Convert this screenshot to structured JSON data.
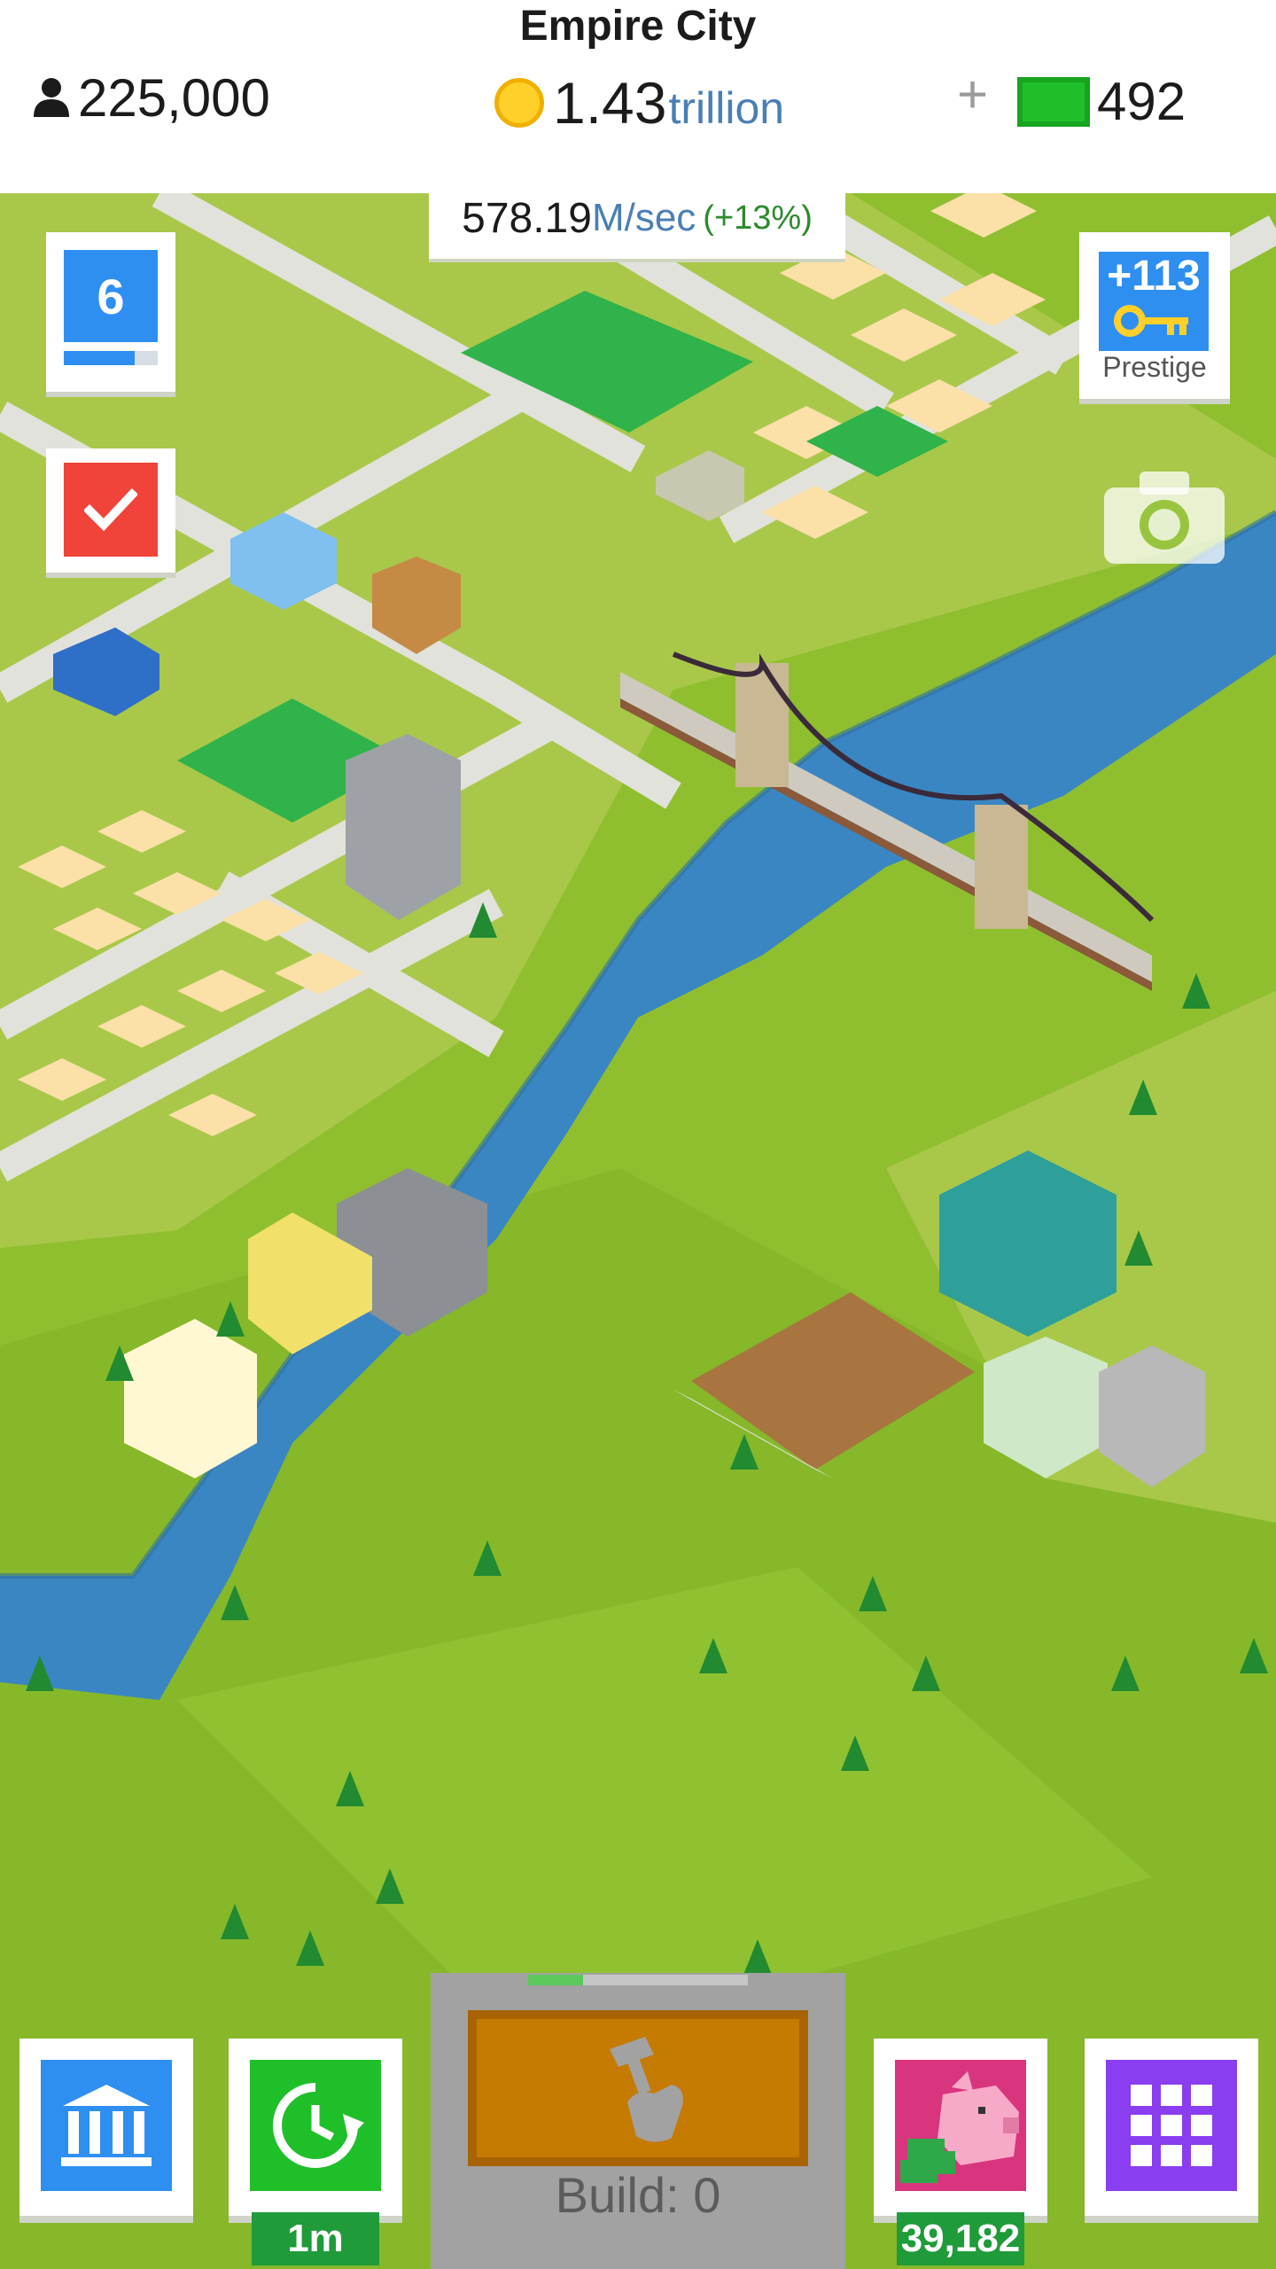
{
  "header": {
    "city_name": "Empire City",
    "population": "225,000",
    "money_value": "1.43",
    "money_unit": "trillion",
    "plus_label": "+",
    "cash": "492"
  },
  "income": {
    "value": "578.19",
    "unit": "M/sec",
    "boost": "(+13%)"
  },
  "level": {
    "value": "6",
    "progress": 0.75
  },
  "prestige": {
    "keys": "+113",
    "label": "Prestige"
  },
  "bottom_bar": {
    "time_warp_label": "1m",
    "piggy_bank_value": "39,182",
    "build_label": "Build: 0",
    "build_progress": 0.25
  },
  "colors": {
    "grass": "#8fbf2f",
    "river": "#3a86c2",
    "road": "#e2e2dc",
    "empty_lot": "#fbe0a8",
    "accent_blue": "#2e8ff0",
    "accent_red": "#f04339",
    "accent_green": "#1f9b3a",
    "accent_purple": "#8b3df0",
    "accent_pink": "#d9357f"
  },
  "icons": [
    "person-icon",
    "coin-icon",
    "cash-icon",
    "checkmark-icon",
    "key-icon",
    "camera-icon",
    "bank-icon",
    "time-warp-icon",
    "hammer-icon",
    "piggy-bank-icon",
    "grid-menu-icon"
  ]
}
